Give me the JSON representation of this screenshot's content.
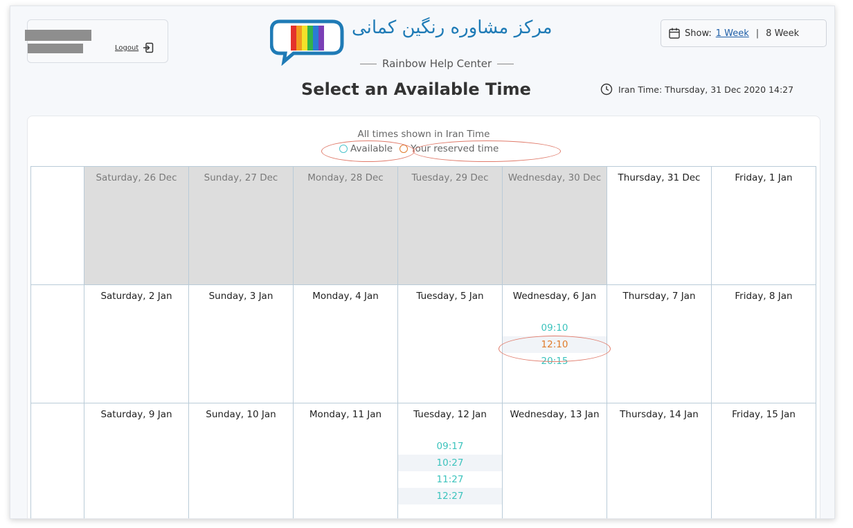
{
  "header": {
    "logout_label": "Logout",
    "logo_persian": "مرکز مشاوره رنگین کمانی",
    "logo_subtitle": "Rainbow Help Center",
    "show_label": "Show:",
    "show_options": [
      "1 Week",
      "8 Week"
    ],
    "selected_option": "1 Week",
    "page_title": "Select an Available Time",
    "iran_time": "Iran Time: Thursday, 31 Dec 2020 14:27"
  },
  "panel": {
    "tz_note": "All times shown in Iran Time",
    "legend_available": "Available",
    "legend_reserved": "Your reserved time"
  },
  "weeks": [
    {
      "days": [
        {
          "label": "Saturday, 26 Dec",
          "past": true,
          "slots": []
        },
        {
          "label": "Sunday, 27 Dec",
          "past": true,
          "slots": []
        },
        {
          "label": "Monday, 28 Dec",
          "past": true,
          "slots": []
        },
        {
          "label": "Tuesday, 29 Dec",
          "past": true,
          "slots": []
        },
        {
          "label": "Wednesday, 30 Dec",
          "past": true,
          "slots": []
        },
        {
          "label": "Thursday, 31 Dec",
          "past": false,
          "slots": []
        },
        {
          "label": "Friday, 1 Jan",
          "past": false,
          "slots": []
        }
      ]
    },
    {
      "days": [
        {
          "label": "Saturday, 2 Jan",
          "past": false,
          "slots": []
        },
        {
          "label": "Sunday, 3 Jan",
          "past": false,
          "slots": []
        },
        {
          "label": "Monday, 4 Jan",
          "past": false,
          "slots": []
        },
        {
          "label": "Tuesday, 5 Jan",
          "past": false,
          "slots": []
        },
        {
          "label": "Wednesday, 6 Jan",
          "past": false,
          "slots": [
            {
              "time": "09:10",
              "reserved": false
            },
            {
              "time": "12:10",
              "reserved": true
            },
            {
              "time": "20:15",
              "reserved": false
            }
          ]
        },
        {
          "label": "Thursday, 7 Jan",
          "past": false,
          "slots": []
        },
        {
          "label": "Friday, 8 Jan",
          "past": false,
          "slots": []
        }
      ]
    },
    {
      "days": [
        {
          "label": "Saturday, 9 Jan",
          "past": false,
          "slots": []
        },
        {
          "label": "Sunday, 10 Jan",
          "past": false,
          "slots": []
        },
        {
          "label": "Monday, 11 Jan",
          "past": false,
          "slots": []
        },
        {
          "label": "Tuesday, 12 Jan",
          "past": false,
          "slots": [
            {
              "time": "09:17",
              "reserved": false
            },
            {
              "time": "10:27",
              "reserved": false
            },
            {
              "time": "11:27",
              "reserved": false
            },
            {
              "time": "12:27",
              "reserved": false
            }
          ]
        },
        {
          "label": "Wednesday, 13 Jan",
          "past": false,
          "slots": []
        },
        {
          "label": "Thursday, 14 Jan",
          "past": false,
          "slots": []
        },
        {
          "label": "Friday, 15 Jan",
          "past": false,
          "slots": []
        }
      ]
    }
  ],
  "colors": {
    "available": "#3cc3bd",
    "reserved": "#e07b2a",
    "past_bg": "#dddddd",
    "annotation": "#e07a6a",
    "link": "#1f5fa8"
  }
}
